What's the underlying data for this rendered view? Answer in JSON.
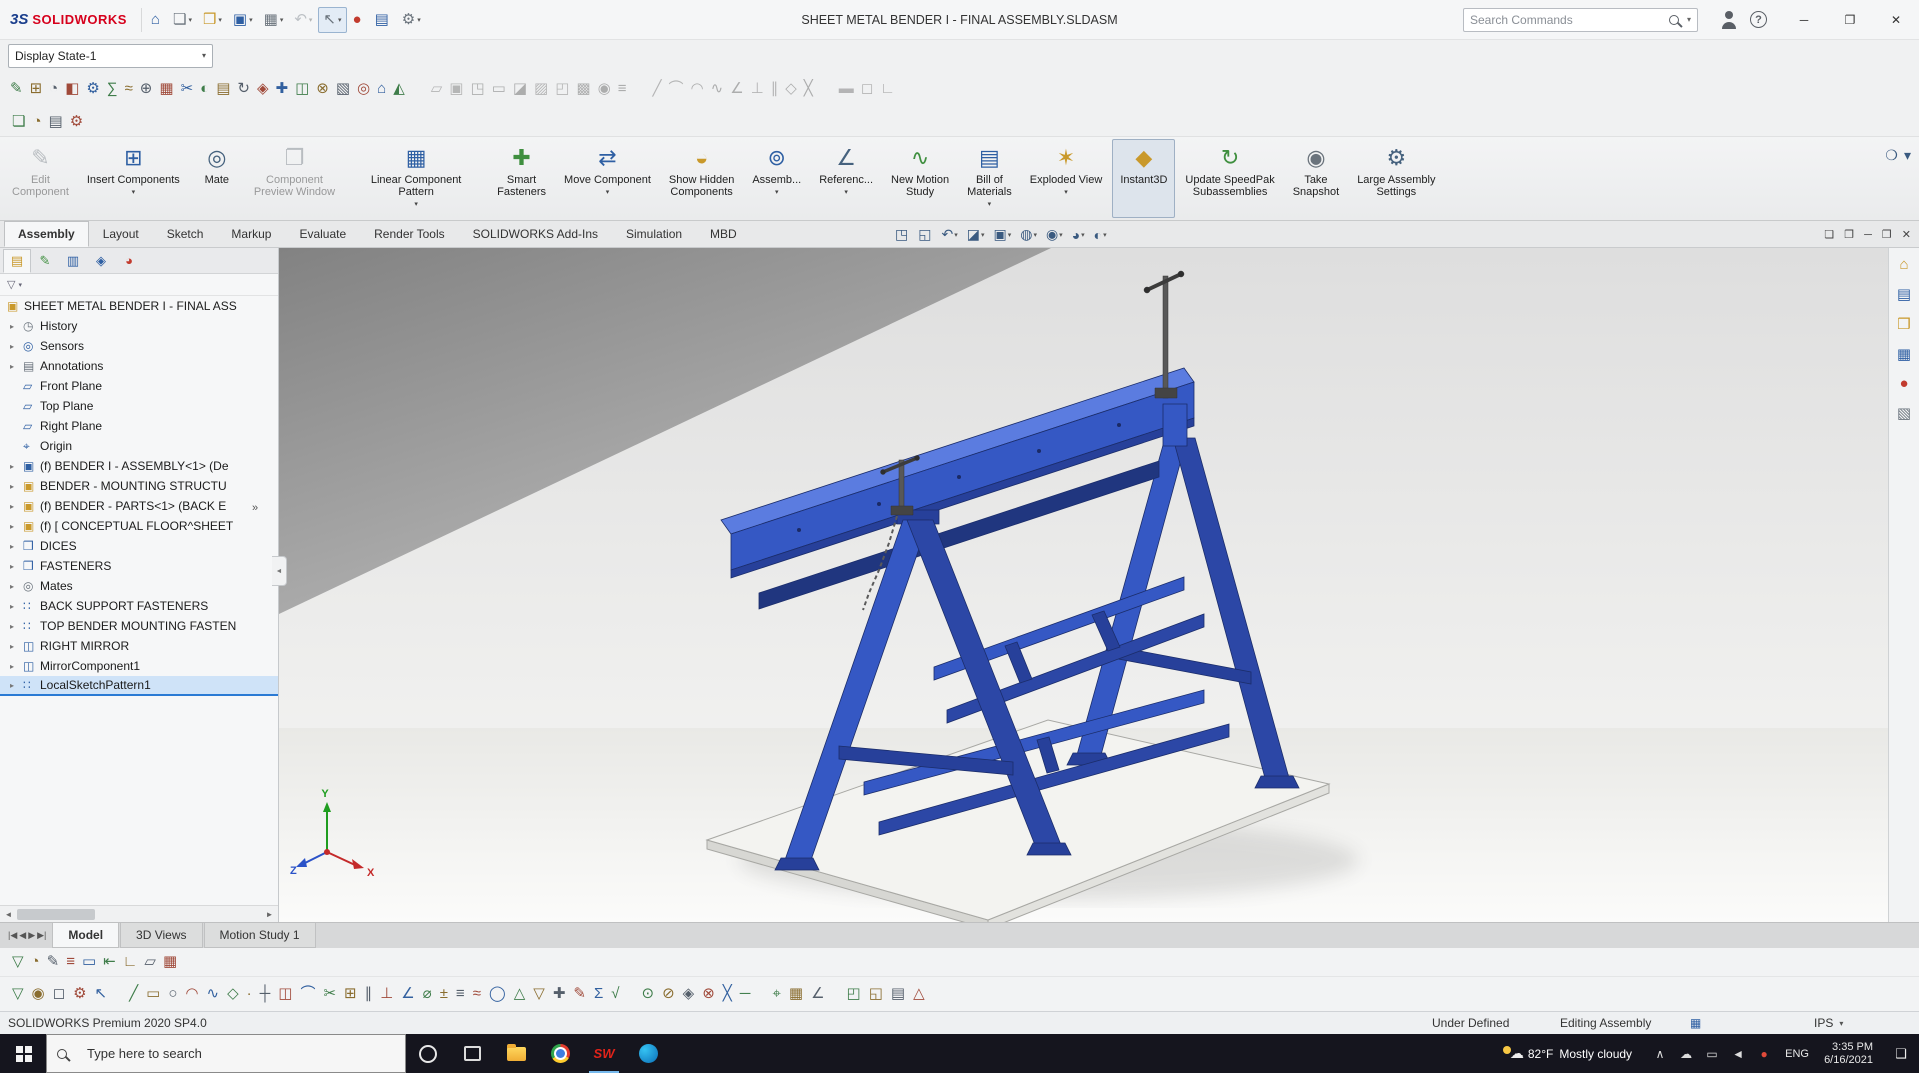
{
  "window": {
    "logo_mark": "3S",
    "app_name": "SOLIDWORKS",
    "title": "SHEET METAL BENDER I - FINAL ASSEMBLY.SLDASM",
    "search_placeholder": "Search Commands",
    "search_caret": "▾",
    "help_glyph": "?",
    "controls": [
      {
        "name": "minimize-button",
        "glyph": "─"
      },
      {
        "name": "restore-button",
        "glyph": "❐"
      },
      {
        "name": "close-button",
        "glyph": "✕"
      }
    ]
  },
  "qat_icons": [
    {
      "name": "home-icon",
      "glyph": "⌂",
      "tone": "blue",
      "caret": ""
    },
    {
      "name": "new-document-icon",
      "glyph": "❏",
      "tone": "gray",
      "caret": "▾"
    },
    {
      "name": "open-document-icon",
      "glyph": "❒",
      "tone": "gold",
      "caret": "▾"
    },
    {
      "name": "save-icon",
      "glyph": "▣",
      "tone": "blue",
      "caret": "▾"
    },
    {
      "name": "print-icon",
      "glyph": "▦",
      "tone": "gray",
      "caret": "▾"
    },
    {
      "name": "undo-icon",
      "glyph": "↶",
      "tone": "gray",
      "caret": "▾",
      "dis": "1"
    },
    {
      "name": "select-arrow-icon",
      "glyph": "↖",
      "tone": "gray",
      "caret": "▾",
      "pressed": "1"
    },
    {
      "name": "rebuild-icon",
      "glyph": "●",
      "tone": "red",
      "caret": ""
    },
    {
      "name": "file-properties-icon",
      "glyph": "▤",
      "tone": "blue",
      "caret": ""
    },
    {
      "name": "options-gear-icon",
      "glyph": "⚙",
      "tone": "gray",
      "caret": "▾"
    }
  ],
  "display_state": {
    "value": "Display State-1",
    "caret": "▾"
  },
  "toolbar_row": {
    "group_a": [
      "✎",
      "⊞",
      "◔",
      "◧",
      "⚙",
      "∑",
      "≈",
      "⊕",
      "▦",
      "✂",
      "◐",
      "▤",
      "↻",
      "◈",
      "✚",
      "◫",
      "⊗",
      "▧",
      "◎",
      "⌂",
      "◭"
    ],
    "group_b": [
      "▱",
      "▣",
      "◳",
      "▭",
      "◪",
      "▨",
      "◰",
      "▩",
      "◉",
      "≡"
    ],
    "group_c": [
      "╱",
      "⌒",
      "◠",
      "∿",
      "∠",
      "⊥",
      "∥",
      "◇",
      "╳"
    ],
    "group_d": [
      "▬",
      "◻",
      "∟"
    ]
  },
  "row_small_icons": [
    "❏",
    "◔",
    "▤",
    "⚙"
  ],
  "ribbon": {
    "buttons": [
      {
        "name": "edit-component-button",
        "glyph": "✎",
        "tone": "gray",
        "label": "Edit\nComponent",
        "caret": "",
        "dis": "1"
      },
      {
        "name": "insert-components-button",
        "glyph": "⊞",
        "tone": "blue",
        "label": "Insert Components",
        "caret": "▾"
      },
      {
        "name": "mate-button",
        "glyph": "◎",
        "tone": "steel",
        "label": "Mate",
        "caret": ""
      },
      {
        "name": "component-preview-window-button",
        "glyph": "❐",
        "tone": "gray",
        "label": "Component\nPreview Window",
        "caret": "",
        "dis": "1"
      },
      {
        "name": "linear-component-pattern-button",
        "glyph": "▦",
        "tone": "blue",
        "label": "Linear Component Pattern",
        "caret": "▾"
      },
      {
        "name": "smart-fasteners-button",
        "glyph": "✚",
        "tone": "green",
        "label": "Smart\nFasteners",
        "caret": ""
      },
      {
        "name": "move-component-button",
        "glyph": "⇄",
        "tone": "blue",
        "label": "Move Component",
        "caret": "▾"
      },
      {
        "name": "show-hidden-components-button",
        "glyph": "◒",
        "tone": "gold",
        "label": "Show Hidden\nComponents",
        "caret": ""
      },
      {
        "name": "assembly-features-button",
        "glyph": "⊚",
        "tone": "blue",
        "label": "Assemb...",
        "caret": "▾"
      },
      {
        "name": "reference-geometry-button",
        "glyph": "∠",
        "tone": "steel",
        "label": "Referenc...",
        "caret": "▾"
      },
      {
        "name": "new-motion-study-button",
        "glyph": "∿",
        "tone": "green",
        "label": "New Motion\nStudy",
        "caret": ""
      },
      {
        "name": "bill-of-materials-button",
        "glyph": "▤",
        "tone": "blue",
        "label": "Bill of\nMaterials",
        "caret": "▾"
      },
      {
        "name": "exploded-view-button",
        "glyph": "✶",
        "tone": "gold",
        "label": "Exploded View",
        "caret": "▾"
      },
      {
        "name": "instant3d-button",
        "glyph": "◆",
        "tone": "gold",
        "label": "Instant3D",
        "caret": "",
        "active": "true"
      },
      {
        "name": "update-speedpak-button",
        "glyph": "↻",
        "tone": "green",
        "label": "Update SpeedPak\nSubassemblies",
        "caret": ""
      },
      {
        "name": "take-snapshot-button",
        "glyph": "◉",
        "tone": "gray",
        "label": "Take\nSnapshot",
        "caret": ""
      },
      {
        "name": "large-assembly-settings-button",
        "glyph": "⚙",
        "tone": "steel",
        "label": "Large Assembly\nSettings",
        "caret": ""
      }
    ],
    "right_icons": [
      {
        "name": "command-finder-icon",
        "glyph": "❍"
      },
      {
        "name": "ribbon-options-caret-icon",
        "glyph": "▾"
      }
    ]
  },
  "tabband": {
    "tabs": [
      {
        "label": "Assembly",
        "active": "true"
      },
      {
        "label": "Layout"
      },
      {
        "label": "Sketch"
      },
      {
        "label": "Markup"
      },
      {
        "label": "Evaluate"
      },
      {
        "label": "Render Tools"
      },
      {
        "label": "SOLIDWORKS Add-Ins"
      },
      {
        "label": "Simulation"
      },
      {
        "label": "MBD"
      }
    ],
    "window_icons": [
      {
        "name": "viewport-arrange-icon",
        "glyph": "❏"
      },
      {
        "name": "viewport-split-icon",
        "glyph": "❐"
      },
      {
        "name": "doc-minimize-button",
        "glyph": "─"
      },
      {
        "name": "doc-restore-button",
        "glyph": "❐"
      },
      {
        "name": "doc-close-button",
        "glyph": "✕"
      }
    ]
  },
  "headsup": [
    {
      "name": "zoom-fit-icon",
      "glyph": "◳",
      "caret": ""
    },
    {
      "name": "zoom-area-icon",
      "glyph": "◱",
      "caret": ""
    },
    {
      "name": "previous-view-icon",
      "glyph": "↶",
      "caret": "▾"
    },
    {
      "name": "section-view-icon",
      "glyph": "◪",
      "caret": "▾"
    },
    {
      "name": "view-orientation-icon",
      "glyph": "▣",
      "caret": "▾"
    },
    {
      "name": "display-style-icon",
      "glyph": "◍",
      "caret": "▾"
    },
    {
      "name": "hide-show-items-icon",
      "glyph": "◉",
      "caret": "▾"
    },
    {
      "name": "edit-appearance-icon",
      "glyph": "◕",
      "caret": "▾"
    },
    {
      "name": "apply-scene-icon",
      "glyph": "◐",
      "caret": "▾"
    }
  ],
  "taskpane": [
    {
      "name": "home-icon",
      "glyph": "⌂",
      "tone": "gold"
    },
    {
      "name": "design-library-icon",
      "glyph": "▤",
      "tone": "blue"
    },
    {
      "name": "file-explorer-icon",
      "glyph": "❒",
      "tone": "gold"
    },
    {
      "name": "view-palette-icon",
      "glyph": "▦",
      "tone": "blue"
    },
    {
      "name": "appearances-icon",
      "glyph": "●",
      "tone": "red"
    },
    {
      "name": "custom-properties-icon",
      "glyph": "▧",
      "tone": "gray"
    }
  ],
  "tree": {
    "tabs": [
      {
        "name": "featuremanager-tab-icon",
        "glyph": "▤",
        "tone": "gold",
        "active": "true"
      },
      {
        "name": "propertymanager-tab-icon",
        "glyph": "✎",
        "tone": "green"
      },
      {
        "name": "configurationmanager-tab-icon",
        "glyph": "▥",
        "tone": "blue"
      },
      {
        "name": "dimxpertmanager-tab-icon",
        "glyph": "◈",
        "tone": "blue"
      },
      {
        "name": "displaymanager-tab-icon",
        "glyph": "◕",
        "tone": "red"
      }
    ],
    "chevron": "»",
    "filter_glyph": "▽",
    "filter_caret": "▾",
    "root": {
      "name": "tree-root-assembly",
      "glyph": "▣",
      "tone": "gold",
      "label": "SHEET METAL BENDER I - FINAL ASS"
    },
    "items": [
      {
        "name": "tree-item-history",
        "arrow": "▸",
        "glyph": "◷",
        "tone": "gray",
        "label": "History"
      },
      {
        "name": "tree-item-sensors",
        "arrow": "▸",
        "glyph": "◎",
        "tone": "blue",
        "label": "Sensors"
      },
      {
        "name": "tree-item-annotations",
        "arrow": "▸",
        "glyph": "▤",
        "tone": "gray",
        "label": "Annotations"
      },
      {
        "name": "tree-item-front-plane",
        "arrow": "",
        "glyph": "▱",
        "tone": "blue",
        "label": "Front Plane"
      },
      {
        "name": "tree-item-top-plane",
        "arrow": "",
        "glyph": "▱",
        "tone": "blue",
        "label": "Top Plane"
      },
      {
        "name": "tree-item-right-plane",
        "arrow": "",
        "glyph": "▱",
        "tone": "blue",
        "label": "Right Plane"
      },
      {
        "name": "tree-item-origin",
        "arrow": "",
        "glyph": "⌖",
        "tone": "blue",
        "label": "Origin"
      },
      {
        "name": "tree-item-bender-assembly",
        "arrow": "▸",
        "glyph": "▣",
        "tone": "blue",
        "label": "(f) BENDER I - ASSEMBLY<1> (De"
      },
      {
        "name": "tree-item-mounting-structure",
        "arrow": "▸",
        "glyph": "▣",
        "tone": "gold",
        "label": "BENDER -  MOUNTING STRUCTU"
      },
      {
        "name": "tree-item-bender-parts",
        "arrow": "▸",
        "glyph": "▣",
        "tone": "gold",
        "label": "(f) BENDER - PARTS<1> (BACK E"
      },
      {
        "name": "tree-item-conceptual-floor",
        "arrow": "▸",
        "glyph": "▣",
        "tone": "gold",
        "label": "(f) [ CONCEPTUAL FLOOR^SHEET"
      },
      {
        "name": "tree-item-dices",
        "arrow": "▸",
        "glyph": "❒",
        "tone": "blue",
        "label": "DICES"
      },
      {
        "name": "tree-item-fasteners",
        "arrow": "▸",
        "glyph": "❒",
        "tone": "blue",
        "label": "FASTENERS"
      },
      {
        "name": "tree-item-mates",
        "arrow": "▸",
        "glyph": "◎",
        "tone": "gray",
        "label": "Mates"
      },
      {
        "name": "tree-item-back-support-fasteners",
        "arrow": "▸",
        "glyph": "∷",
        "tone": "blue",
        "label": "BACK SUPPORT FASTENERS"
      },
      {
        "name": "tree-item-top-bender-fasteners",
        "arrow": "▸",
        "glyph": "∷",
        "tone": "blue",
        "label": "TOP BENDER MOUNTING FASTEN"
      },
      {
        "name": "tree-item-right-mirror",
        "arrow": "▸",
        "glyph": "◫",
        "tone": "blue",
        "label": "RIGHT MIRROR"
      },
      {
        "name": "tree-item-mirrorcomponent1",
        "arrow": "▸",
        "glyph": "◫",
        "tone": "blue",
        "label": "MirrorComponent1"
      },
      {
        "name": "tree-item-localsketchpattern1",
        "arrow": "▸",
        "glyph": "∷",
        "tone": "blue",
        "label": "LocalSketchPattern1",
        "selected": "true"
      }
    ],
    "hscroll_left": "◄",
    "hscroll_right": "►",
    "collapse_glyph": "◄"
  },
  "viewport": {
    "triad": {
      "x": "X",
      "y": "Y",
      "z": "Z"
    }
  },
  "model_tabs": {
    "scroll": [
      {
        "name": "first-tab-button",
        "glyph": "|◀"
      },
      {
        "name": "prev-tab-button",
        "glyph": "◀"
      },
      {
        "name": "next-tab-button",
        "glyph": "▶"
      },
      {
        "name": "last-tab-button",
        "glyph": "▶|"
      }
    ],
    "items": [
      {
        "label": "Model",
        "active": "true"
      },
      {
        "label": "3D Views"
      },
      {
        "label": "Motion Study 1"
      }
    ]
  },
  "sketch_rows": {
    "row_a": [
      "▽",
      "◔",
      "✎",
      "≡",
      "▭",
      "⇤",
      "∟",
      "▱",
      "▦"
    ],
    "row_b_1": [
      "▽",
      "◉",
      "◻",
      "⚙",
      "↖"
    ],
    "row_b_2": [
      "╱",
      "▭",
      "○",
      "◠",
      "∿",
      "◇",
      "·",
      "┼",
      "◫",
      "⌒",
      "✂",
      "⊞",
      "∥",
      "⊥",
      "∠",
      "⌀",
      "±",
      "≡",
      "≈",
      "◯",
      "△",
      "▽",
      "✚",
      "✎",
      "Σ",
      "√"
    ],
    "row_b_3": [
      "⊙",
      "⊘",
      "◈",
      "⊗",
      "╳",
      "─"
    ],
    "row_b_4": [
      "⌖",
      "▦",
      "∠"
    ],
    "row_b_5": [
      "◰",
      "◱",
      "▤",
      "△"
    ]
  },
  "status_bar": {
    "product": "SOLIDWORKS Premium 2020 SP4.0",
    "define_status": "Under Defined",
    "mode": "Editing Assembly",
    "status_glyph": "▦",
    "units": "IPS",
    "units_caret": "▾"
  },
  "taskbar": {
    "search_placeholder": "Type here to search",
    "weather_glyph": "☁",
    "weather_temp": "82°F",
    "weather_desc": "Mostly cloudy",
    "lang": "ENG",
    "time": "3:35 PM",
    "date": "6/16/2021",
    "app_icons": [
      {
        "name": "cortana-icon",
        "icon": "cortana",
        "label": ""
      },
      {
        "name": "task-view-icon",
        "icon": "taskview",
        "label": ""
      },
      {
        "name": "file-explorer-icon",
        "icon": "explorer",
        "label": ""
      },
      {
        "name": "chrome-icon",
        "icon": "chrome",
        "label": ""
      },
      {
        "name": "solidworks-icon",
        "icon": "sw",
        "label": "SW",
        "running": "1"
      },
      {
        "name": "edge-icon",
        "icon": "edge",
        "label": ""
      }
    ],
    "tray": [
      {
        "name": "hidden-icons-chevron-icon",
        "glyph": "∧"
      },
      {
        "name": "onedrive-icon",
        "glyph": "☁"
      },
      {
        "name": "display-icon",
        "glyph": "▭"
      },
      {
        "name": "volume-icon",
        "glyph": "◄"
      },
      {
        "name": "alert-badge-icon",
        "glyph": "●",
        "tone": "red"
      }
    ],
    "notification_glyph": "❑"
  }
}
